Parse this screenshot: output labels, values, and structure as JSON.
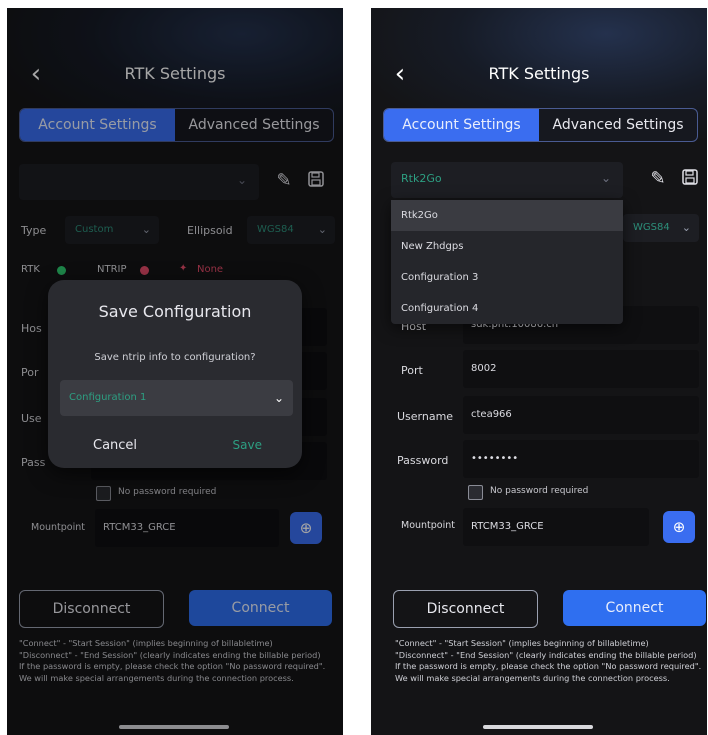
{
  "screens": {
    "left": {
      "title": "RTK Settings",
      "tabs": [
        "Account Settings",
        "Advanced Settings"
      ],
      "config_select": "",
      "type_label": "Type",
      "type_value": "Custom",
      "ellipsoid_label": "Ellipsoid",
      "ellipsoid_value": "WGS84",
      "rtk_label": "RTK",
      "ntrip_label": "NTRIP",
      "none_label": "None",
      "host_label": "Hos",
      "port_label": "Por",
      "username_label": "Use",
      "password_label": "Pass",
      "no_password_label": "No password required",
      "mountpoint_label": "Mountpoint",
      "mountpoint_value": "RTCM33_GRCE",
      "modal": {
        "title": "Save Configuration",
        "message": "Save ntrip info to configuration?",
        "selected": "Configuration 1",
        "cancel": "Cancel",
        "save": "Save"
      },
      "disconnect": "Disconnect",
      "connect": "Connect"
    },
    "right": {
      "title": "RTK Settings",
      "tabs": [
        "Account Settings",
        "Advanced Settings"
      ],
      "config_select": "Rtk2Go",
      "dropdown_items": [
        "Rtk2Go",
        "New Zhdgps",
        "Configuration 3",
        "Configuration 4"
      ],
      "ellipsoid_value": "WGS84",
      "host_label": "Host",
      "host_value": "sdk.pnt.10086.cn",
      "port_label": "Port",
      "port_value": "8002",
      "username_label": "Username",
      "username_value": "ctea966",
      "password_label": "Password",
      "password_value": "••••••••",
      "no_password_label": "No password required",
      "mountpoint_label": "Mountpoint",
      "mountpoint_value": "RTCM33_GRCE",
      "disconnect": "Disconnect",
      "connect": "Connect"
    }
  },
  "notes": {
    "line1": "\"Connect\" - \"Start Session\" (implies beginning of billabletime)",
    "line2": "\"Disconnect\" - \"End Session\" (clearly indicates ending the billable period)",
    "line3": "If the password is empty, please check the option \"No password required\". We will make special arrangements during the connection process."
  },
  "colors": {
    "accent": "#3a6df0",
    "rtk_status": "#2ecc71",
    "ntrip_status": "#e74c6a",
    "none_status": "#e74c6a",
    "save_green": "#2d9f82"
  },
  "icons": [
    "back-chevron-icon",
    "edit-icon",
    "save-disk-icon",
    "chevron-down-icon",
    "globe-icon",
    "satellite-icon"
  ]
}
